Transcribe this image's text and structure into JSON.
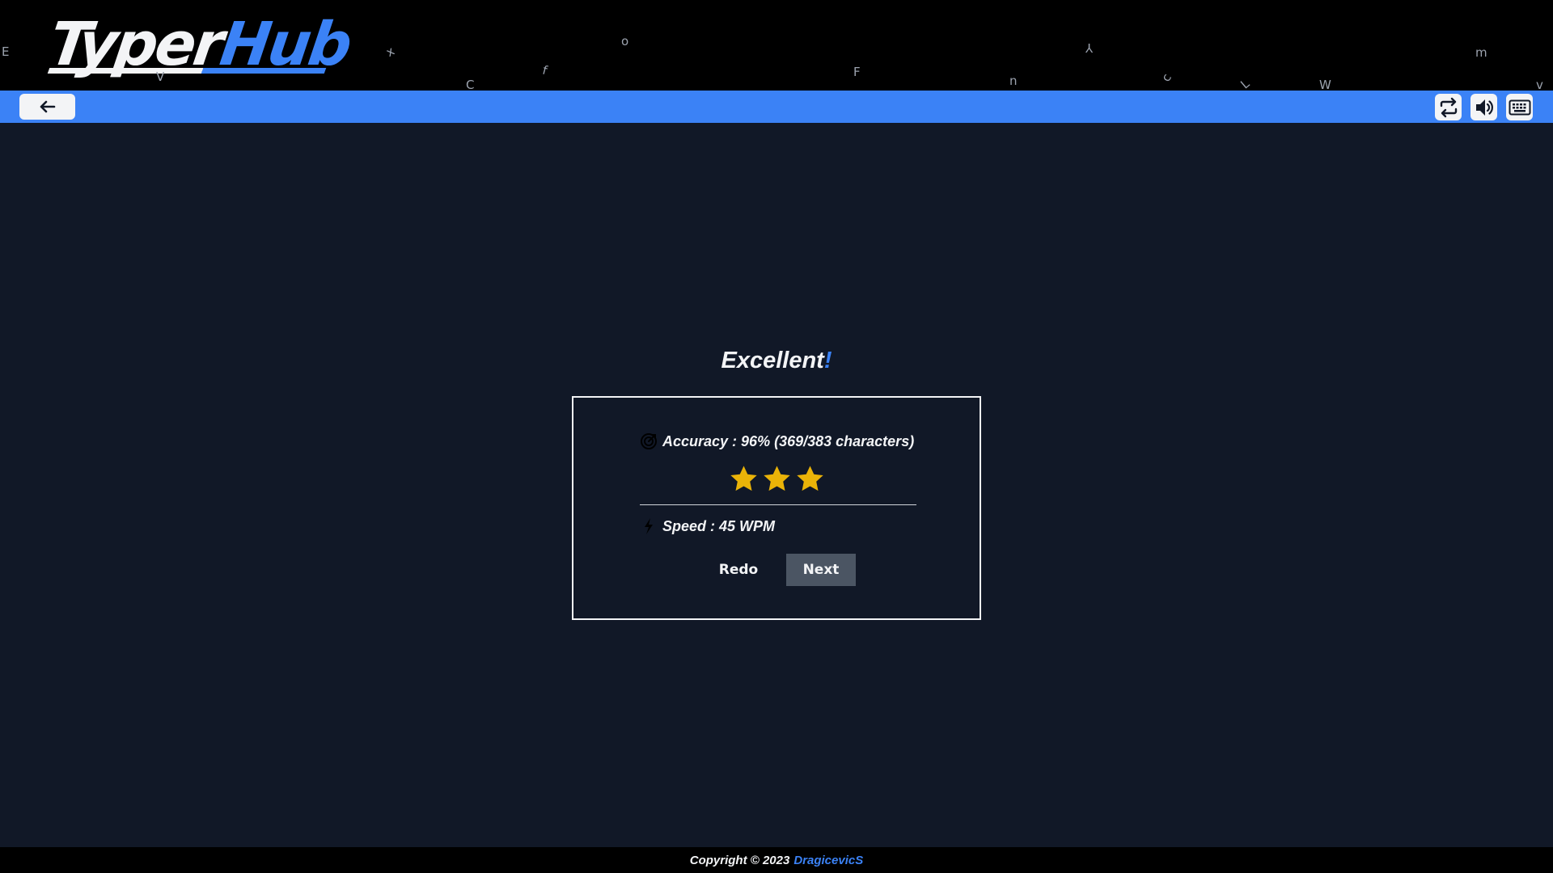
{
  "header": {
    "logo_part1": "Typer",
    "logo_part2": "Hub",
    "floating_letters": [
      "E",
      "V",
      "x",
      "C",
      "f",
      "o",
      "F",
      "n",
      "Y",
      "c",
      "L",
      "W",
      "m",
      "v"
    ]
  },
  "toolbar": {
    "back_icon": "arrow-left-icon",
    "buttons": [
      {
        "icon": "repeat-icon"
      },
      {
        "icon": "volume-icon"
      },
      {
        "icon": "keyboard-icon"
      }
    ]
  },
  "result": {
    "title": "Excellent",
    "title_punct": "!",
    "accuracy_text": "Accuracy : 96% (369/383 characters)",
    "accuracy_percent": 96,
    "correct_characters": 369,
    "total_characters": 383,
    "stars_filled": 3,
    "stars_total": 3,
    "speed_text": "Speed : 45 WPM",
    "speed_wpm": 45,
    "redo_label": "Redo",
    "next_label": "Next"
  },
  "footer": {
    "copyright": "Copyright © 2023",
    "author": "DragicevicS"
  },
  "colors": {
    "background": "#111827",
    "header_bg": "#000000",
    "toolbar_bg": "#3b82f6",
    "accent": "#3b82f6",
    "star": "#eab308",
    "next_button_bg": "#4b5563"
  }
}
